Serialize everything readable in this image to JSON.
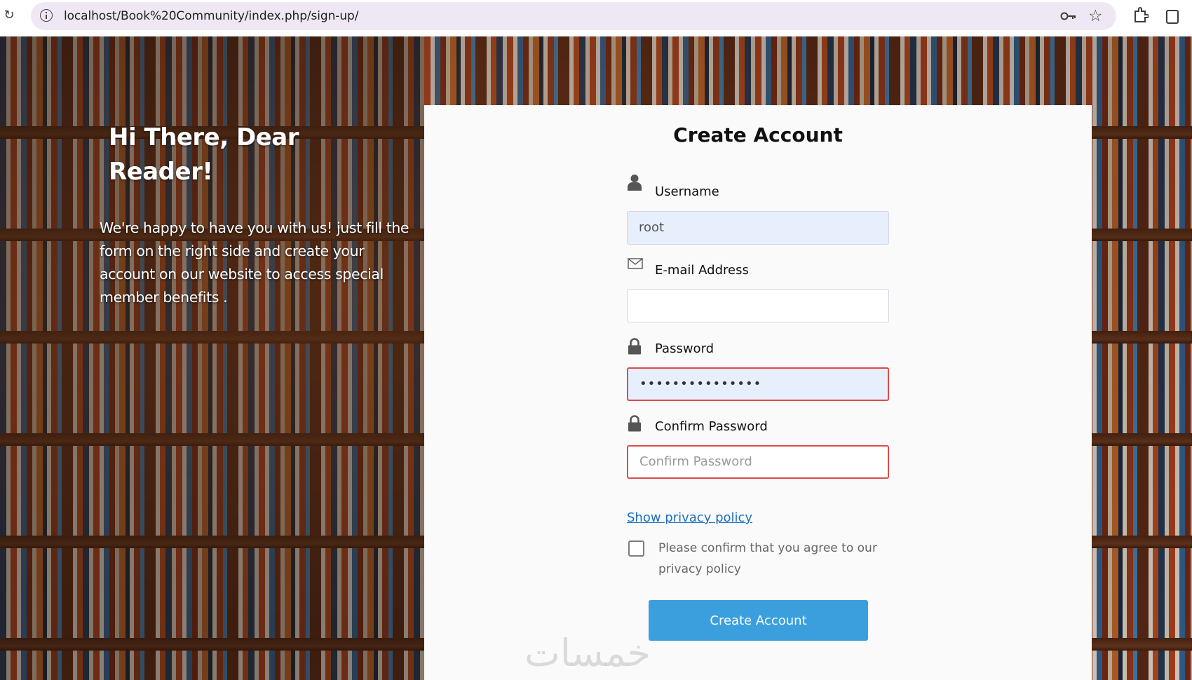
{
  "browser": {
    "url": "localhost/Book%20Community/index.php/sign-up/",
    "icons": [
      "reload-icon",
      "info-icon",
      "key-icon",
      "star-icon",
      "extensions-icon",
      "side-panel-icon"
    ]
  },
  "welcome": {
    "title": "Hi There, Dear Reader!",
    "text": "We're happy to have you with us! just fill the form on the right side and create your account on our website to access special member benefits ."
  },
  "form": {
    "title": "Create Account",
    "username": {
      "label": "Username",
      "value": "root",
      "icon": "user-icon"
    },
    "email": {
      "label": "E-mail Address",
      "value": "",
      "icon": "envelope-icon"
    },
    "password": {
      "label": "Password",
      "masked_value": "•••••••••••••••",
      "icon": "lock-icon"
    },
    "confirm_password": {
      "label": "Confirm Password",
      "placeholder": "Confirm Password",
      "icon": "lock-icon"
    },
    "privacy_link": "Show privacy policy",
    "checkbox_label": "Please confirm that you agree to our privacy policy",
    "submit_label": "Create Account"
  },
  "watermark": "خمسات",
  "colors": {
    "accent": "#3a9fdc",
    "link": "#1a6fc4",
    "error_border": "#e24a4a",
    "autofill_bg": "#e8effc"
  }
}
